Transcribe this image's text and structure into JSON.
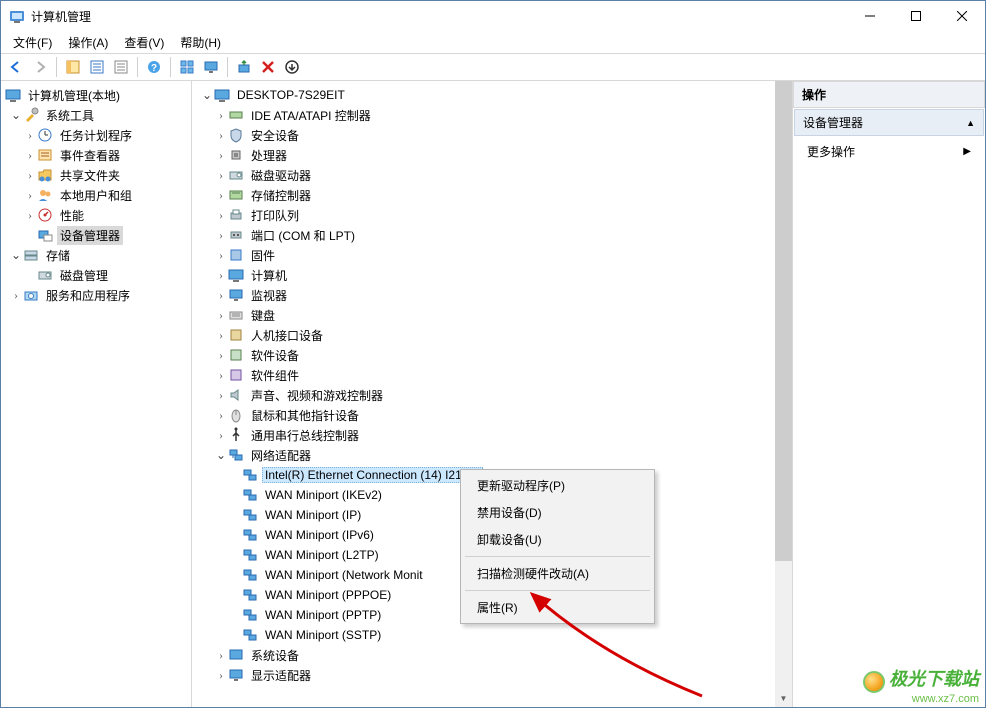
{
  "window": {
    "title": "计算机管理"
  },
  "menus": {
    "file": "文件(F)",
    "action": "操作(A)",
    "view": "查看(V)",
    "help": "帮助(H)"
  },
  "left_tree": {
    "root": "计算机管理(本地)",
    "system_tools": "系统工具",
    "task_scheduler": "任务计划程序",
    "event_viewer": "事件查看器",
    "shared_folders": "共享文件夹",
    "local_users": "本地用户和组",
    "performance": "性能",
    "device_manager": "设备管理器",
    "storage": "存储",
    "disk_mgmt": "磁盘管理",
    "services_apps": "服务和应用程序"
  },
  "mid_tree": {
    "host": "DESKTOP-7S29EIT",
    "ide": "IDE ATA/ATAPI 控制器",
    "security": "安全设备",
    "cpu": "处理器",
    "disk": "磁盘驱动器",
    "storage_ctrl": "存储控制器",
    "print_queue": "打印队列",
    "ports": "端口 (COM 和 LPT)",
    "firmware": "固件",
    "computer": "计算机",
    "monitor": "监视器",
    "keyboard": "键盘",
    "hid": "人机接口设备",
    "soft_dev": "软件设备",
    "soft_comp": "软件组件",
    "sound": "声音、视频和游戏控制器",
    "mouse": "鼠标和其他指针设备",
    "usb": "通用串行总线控制器",
    "net": "网络适配器",
    "net_sel": "Intel(R) Ethernet Connection (14) I219-V",
    "wan1": "WAN Miniport (IKEv2)",
    "wan2": "WAN Miniport (IP)",
    "wan3": "WAN Miniport (IPv6)",
    "wan4": "WAN Miniport (L2TP)",
    "wan5": "WAN Miniport (Network Monit",
    "wan6": "WAN Miniport (PPPOE)",
    "wan7": "WAN Miniport (PPTP)",
    "wan8": "WAN Miniport (SSTP)",
    "sys_dev": "系统设备",
    "display": "显示适配器"
  },
  "context_menu": {
    "update": "更新驱动程序(P)",
    "disable": "禁用设备(D)",
    "uninstall": "卸载设备(U)",
    "scan": "扫描检测硬件改动(A)",
    "properties": "属性(R)"
  },
  "actions": {
    "header": "操作",
    "section": "设备管理器",
    "more": "更多操作"
  },
  "watermark": {
    "name": "极光下载站",
    "url": "www.xz7.com"
  }
}
